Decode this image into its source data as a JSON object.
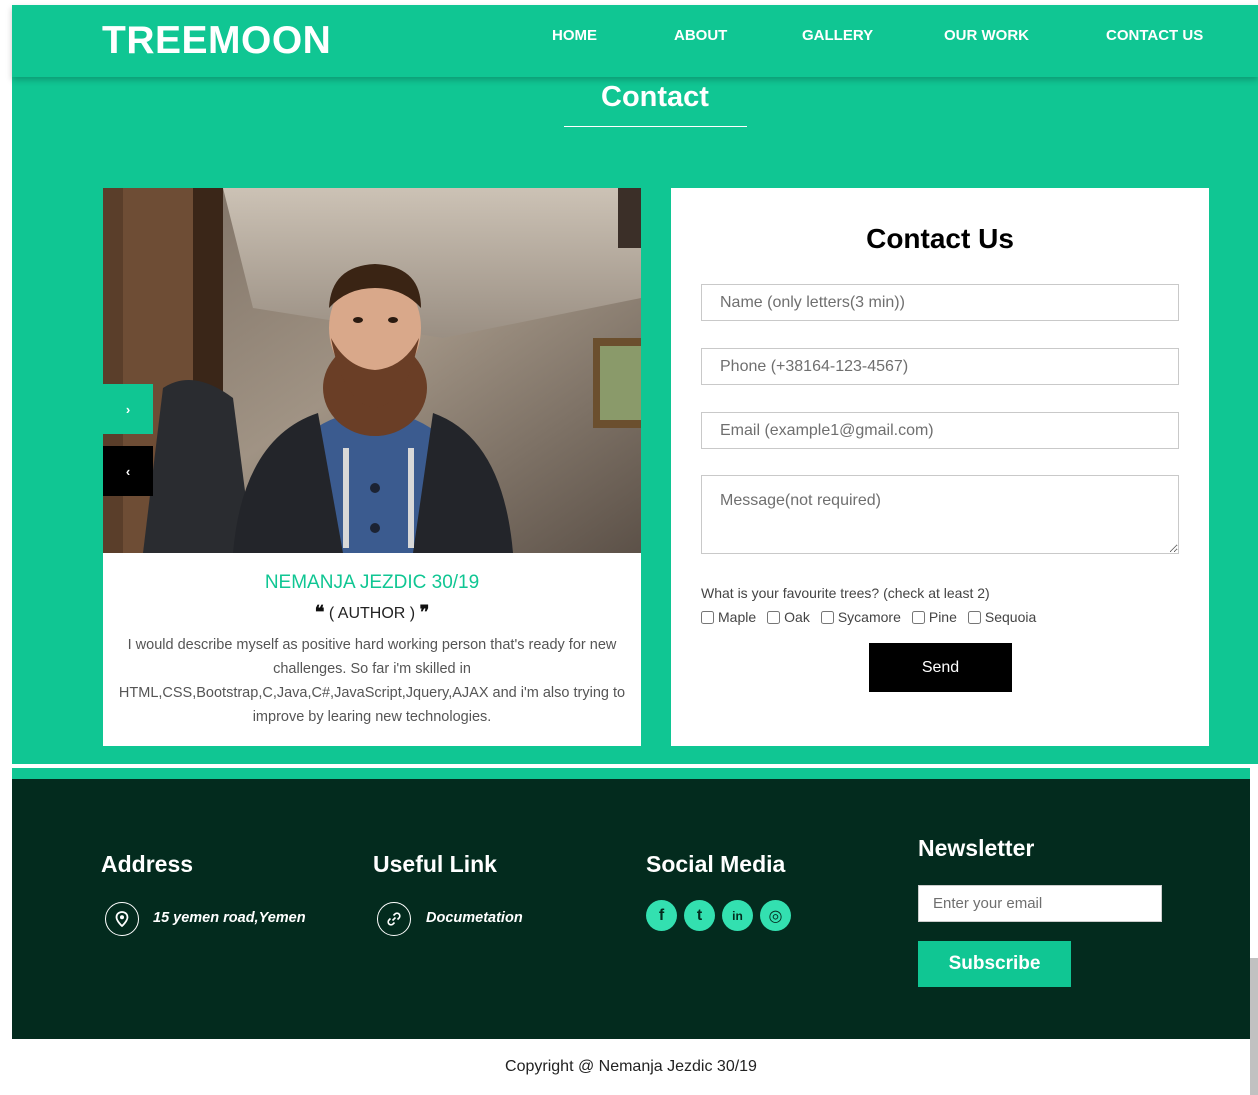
{
  "brand": "TREEMOON",
  "nav": {
    "items": [
      {
        "label": "HOME"
      },
      {
        "label": "ABOUT"
      },
      {
        "label": "GALLERY"
      },
      {
        "label": "OUR WORK"
      },
      {
        "label": "CONTACT US"
      }
    ]
  },
  "section": {
    "title": "Contact"
  },
  "profile": {
    "name": "NEMANJA JEZDIC 30/19",
    "role": "( AUTHOR )",
    "bio": "I would describe myself as positive hard working person that's ready for new challenges. So far i'm skilled in HTML,CSS,Bootstrap,C,Java,C#,JavaScript,Jquery,AJAX and i'm also trying to improve by learing new technologies.",
    "next_icon": "chevron-right-icon",
    "prev_icon": "chevron-left-icon"
  },
  "form": {
    "title": "Contact Us",
    "name_placeholder": "Name (only letters(3 min))",
    "phone_placeholder": "Phone (+38164-123-4567)",
    "email_placeholder": "Email (example1@gmail.com)",
    "message_placeholder": "Message(not required)",
    "trees_question": "What is your favourite trees? (check at least 2)",
    "trees": [
      "Maple",
      "Oak",
      "Sycamore",
      "Pine",
      "Sequoia"
    ],
    "send_label": "Send"
  },
  "footer": {
    "address": {
      "heading": "Address",
      "text": "15 yemen road,Yemen",
      "icon": "map-pin-icon"
    },
    "useful": {
      "heading": "Useful Link",
      "text": "Documetation",
      "icon": "link-icon"
    },
    "social": {
      "heading": "Social Media",
      "icons": [
        {
          "name": "facebook-icon",
          "glyph": "f"
        },
        {
          "name": "twitter-icon",
          "glyph": "t"
        },
        {
          "name": "linkedin-icon",
          "glyph": "in"
        },
        {
          "name": "instagram-icon",
          "glyph": "◎"
        }
      ]
    },
    "newsletter": {
      "heading": "Newsletter",
      "placeholder": "Enter your email",
      "button": "Subscribe"
    }
  },
  "copyright": "Copyright @ Nemanja Jezdic 30/19",
  "colors": {
    "primary": "#10c693",
    "footer_bg": "#032b1e",
    "social_icon": "#33e0b0"
  }
}
